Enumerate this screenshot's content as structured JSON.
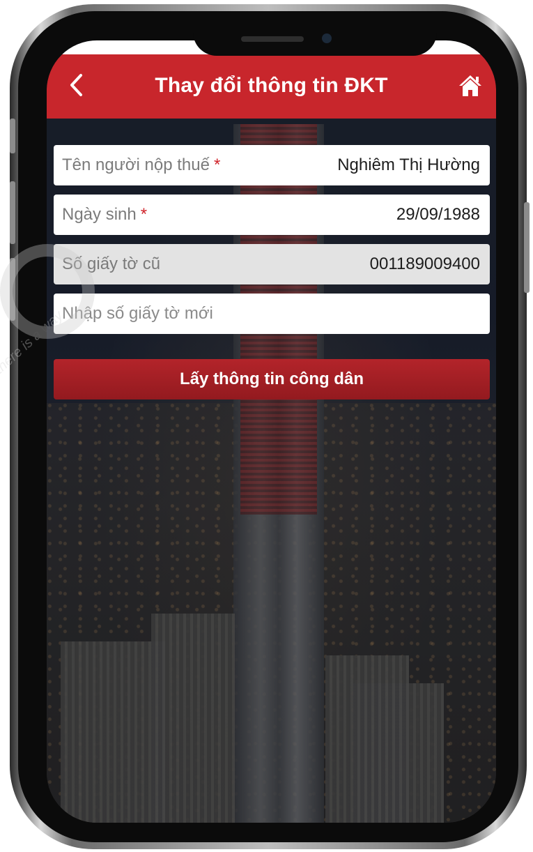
{
  "header": {
    "title": "Thay đổi thông tin ĐKT",
    "back_icon": "chevron-left-icon",
    "home_icon": "home-icon"
  },
  "form": {
    "taxpayer_name": {
      "label": "Tên người nộp thuế",
      "required_mark": "*",
      "value": "Nghiêm Thị Hường"
    },
    "birth_date": {
      "label": "Ngày sinh",
      "required_mark": "*",
      "value": "29/09/1988"
    },
    "old_id": {
      "label": "Số giấy tờ cũ",
      "value": "001189009400"
    },
    "new_id": {
      "placeholder": "Nhập số giấy tờ mới",
      "value": ""
    },
    "submit_label": "Lấy thông tin công dân"
  },
  "watermark": {
    "text": "there is a way"
  },
  "colors": {
    "header": "#c8262c",
    "button": "#a51f25",
    "required": "#d0242b"
  }
}
